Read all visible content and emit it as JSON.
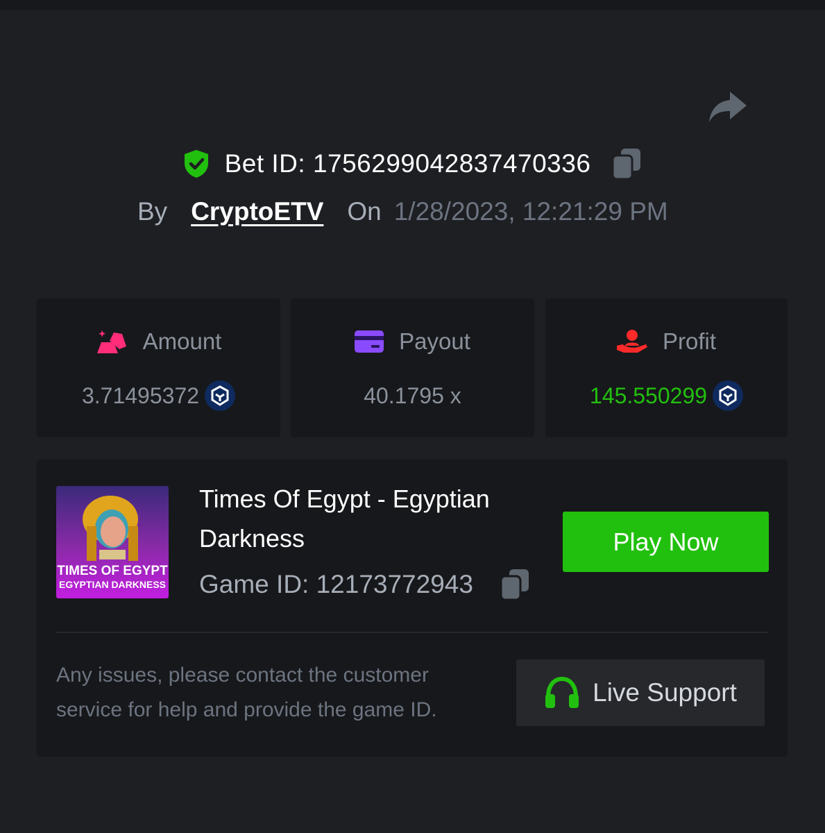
{
  "header": {
    "bet_id_label": "Bet ID: 1756299042837470336",
    "by_label": "By",
    "username": "CryptoETV",
    "on_label": "On",
    "datetime": "1/28/2023, 12:21:29 PM"
  },
  "stats": {
    "amount": {
      "label": "Amount",
      "value": "3.71495372",
      "icon": "gold-bars-icon",
      "color": "#ff2d7a"
    },
    "payout": {
      "label": "Payout",
      "value": "40.1795 x",
      "icon": "credit-card-icon",
      "color": "#8a4bff"
    },
    "profit": {
      "label": "Profit",
      "value": "145.550299",
      "icon": "hand-user-icon",
      "color": "#ff2a2a",
      "value_color": "#22c00e"
    }
  },
  "game": {
    "title": "Times Of Egypt - Egyptian Darkness",
    "game_id_label": "Game ID: 12173772943",
    "thumbnail_line1": "TIMES OF EGYPT",
    "thumbnail_line2": "EGYPTIAN DARKNESS",
    "play_label": "Play Now"
  },
  "support": {
    "help_text": "Any issues, please contact the customer service for help and provide the game ID.",
    "button_label": "Live Support"
  },
  "colors": {
    "background": "#1e1f23",
    "card": "#17181b",
    "accent_green": "#22c00e",
    "coin_blue": "#0f2a5e"
  }
}
